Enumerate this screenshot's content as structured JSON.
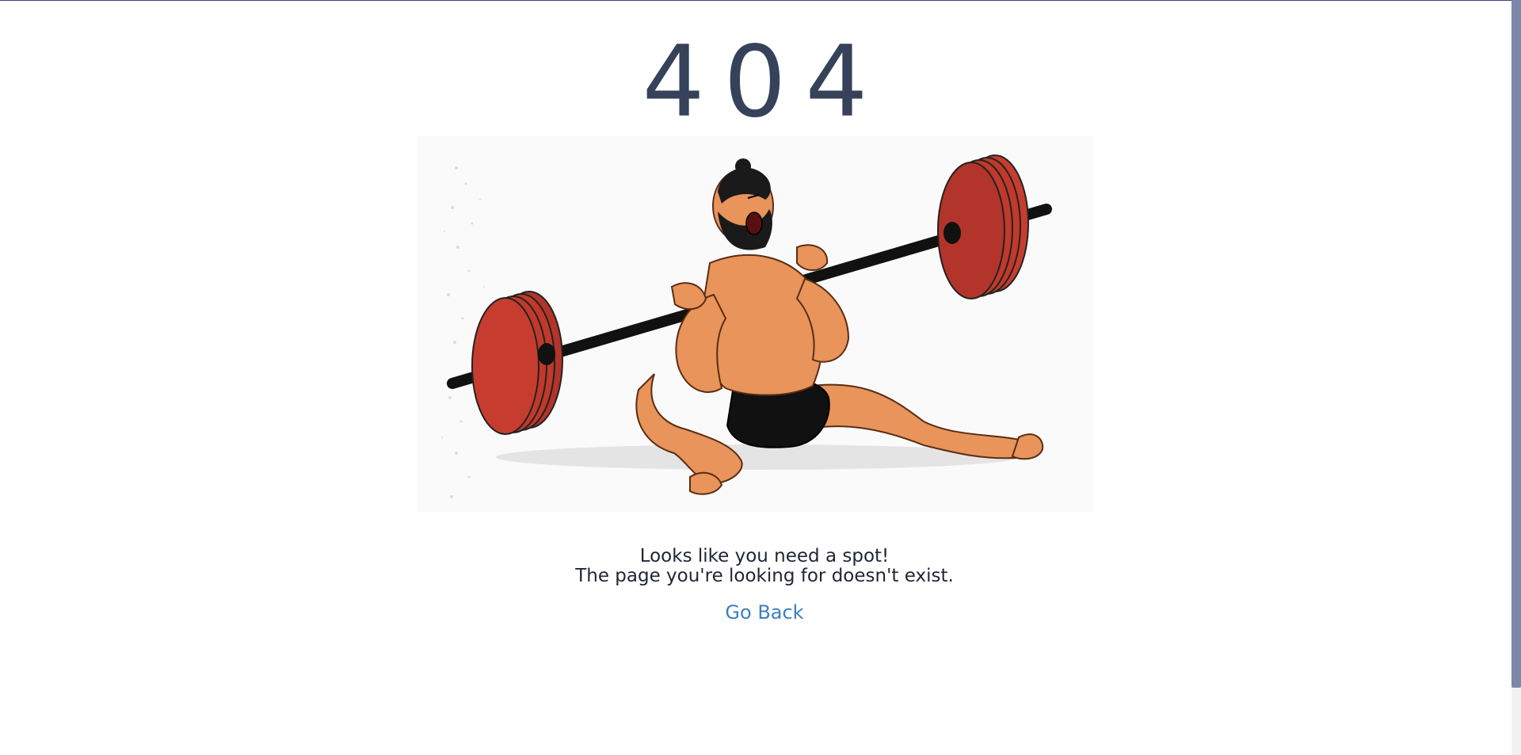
{
  "error": {
    "code": "404"
  },
  "illustration": {
    "description_icon": "weightlifter-illustration",
    "plate_color": "#c0392b",
    "bar_color": "#111111",
    "skin_color": "#e8945a"
  },
  "message": {
    "line1": "Looks like you need a spot!",
    "line2": "The page you're looking for doesn't exist."
  },
  "actions": {
    "go_back_label": "Go Back"
  },
  "colors": {
    "code_text": "#354259",
    "link": "#3d7fc4",
    "body_text": "#1f2533"
  }
}
